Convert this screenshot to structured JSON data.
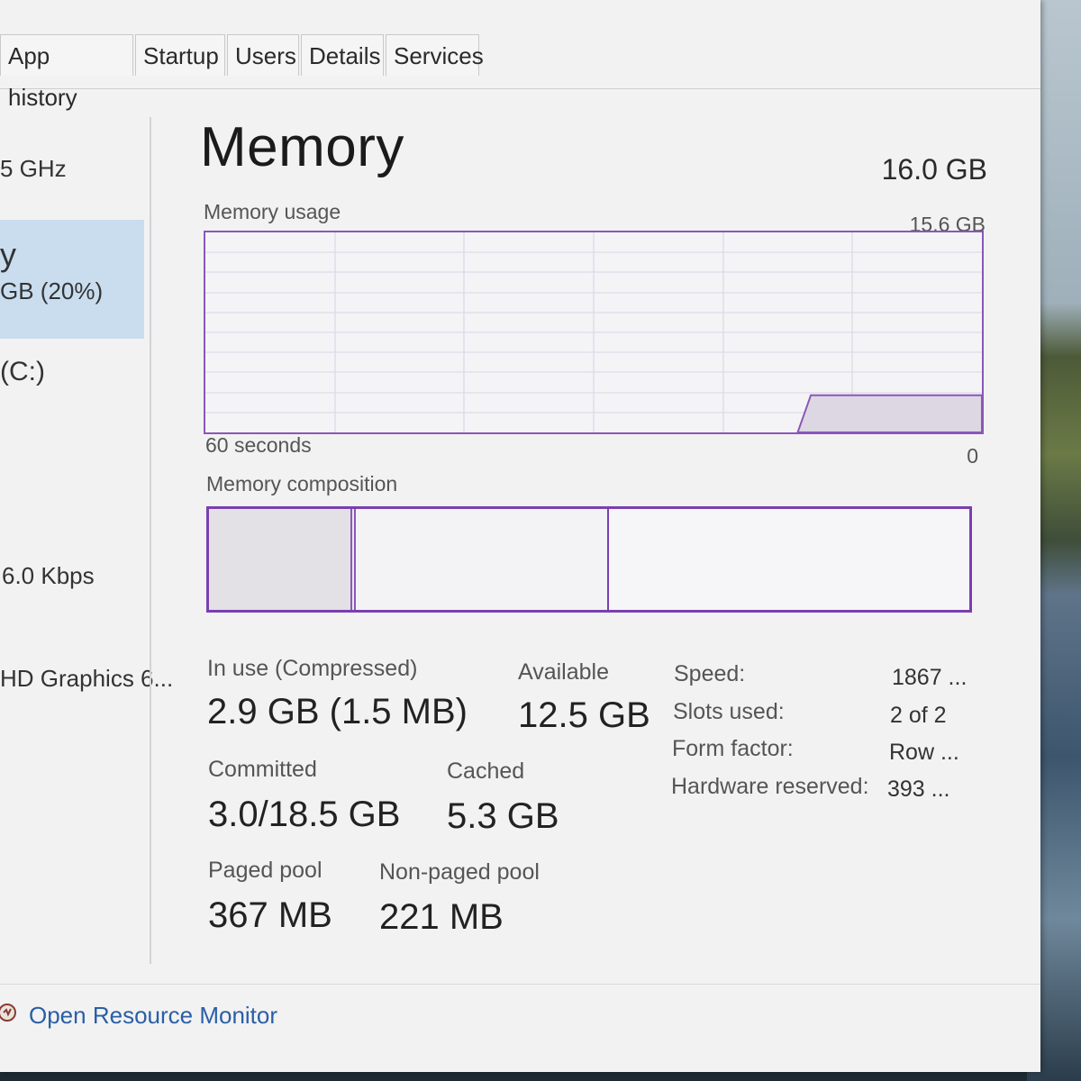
{
  "tabs": [
    "App history",
    "Startup",
    "Users",
    "Details",
    "Services"
  ],
  "sidebar": {
    "cpu_speed": "5 GHz",
    "memory_title": "y",
    "memory_usage": "GB (20%)",
    "disk_label": "(C:)",
    "ethernet_rate": "6.0 Kbps",
    "gpu_label": "HD Graphics 6..."
  },
  "main": {
    "title": "Memory",
    "total": "16.0 GB",
    "usage_label": "Memory usage",
    "usage_max": "15.6 GB",
    "time_span": "60 seconds",
    "axis_zero": "0",
    "composition_label": "Memory composition"
  },
  "stats": {
    "in_use_label": "In use (Compressed)",
    "in_use_value": "2.9 GB (1.5 MB)",
    "available_label": "Available",
    "available_value": "12.5 GB",
    "committed_label": "Committed",
    "committed_value": "3.0/18.5 GB",
    "cached_label": "Cached",
    "cached_value": "5.3 GB",
    "paged_label": "Paged pool",
    "paged_value": "367 MB",
    "nonpaged_label": "Non-paged pool",
    "nonpaged_value": "221 MB"
  },
  "properties": [
    {
      "label": "Speed:",
      "value": "1867 ..."
    },
    {
      "label": "Slots used:",
      "value": "2 of 2"
    },
    {
      "label": "Form factor:",
      "value": "Row ..."
    },
    {
      "label": "Hardware reserved:",
      "value": "393 ..."
    }
  ],
  "footer": {
    "resource_monitor": "Open Resource Monitor"
  },
  "colors": {
    "accent": "#8a57b8",
    "selected": "#c9ddef",
    "link": "#2a5fa6"
  },
  "chart_data": {
    "type": "area",
    "series": [
      {
        "values": [
          0,
          0,
          0,
          0,
          0,
          0,
          0,
          0,
          0,
          0,
          0,
          0,
          0,
          0,
          0,
          0,
          0,
          0,
          0,
          0,
          0,
          0,
          0,
          0,
          0,
          0,
          0,
          0,
          0,
          0,
          0,
          0,
          0,
          0,
          0,
          0,
          0,
          0,
          0,
          0,
          0,
          0,
          0,
          0,
          0,
          0,
          2.9,
          2.9,
          2.9,
          2.9,
          2.9,
          2.9,
          2.9,
          2.9,
          2.9,
          2.9,
          2.9,
          2.9,
          2.9,
          2.9
        ]
      }
    ],
    "xlabel": "60 seconds",
    "ylim": [
      0,
      15.6
    ],
    "grid": true
  },
  "composition": {
    "in_use_gb": 2.9,
    "modified_gb": 0.1,
    "standby_gb": 5.2,
    "free_gb": 7.4
  }
}
